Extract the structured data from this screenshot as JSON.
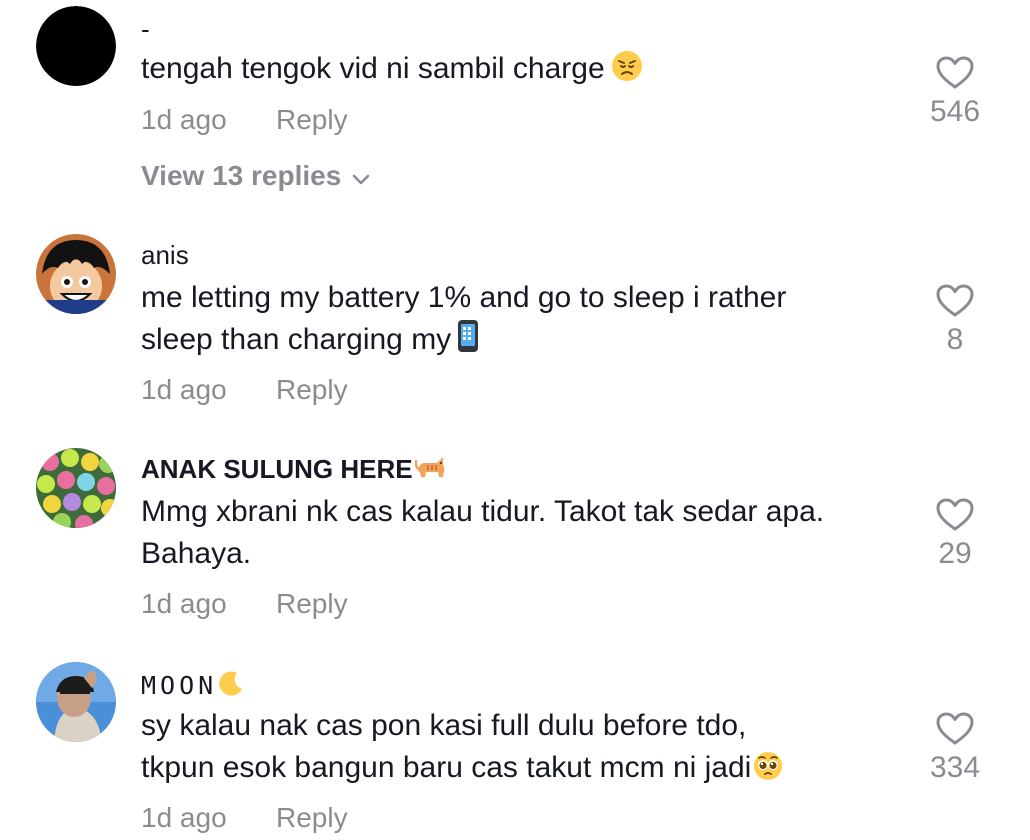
{
  "comments": [
    {
      "username": "-",
      "text": "tengah tengok vid ni sambil charge",
      "emoji": "disappointed-face",
      "time": "1d ago",
      "reply_label": "Reply",
      "likes": "546",
      "view_replies": "View 13 replies"
    },
    {
      "username": "anis",
      "text_line1": "me letting my battery 1% and go to sleep i rather",
      "text_line2": "sleep than charging my",
      "emoji": "mobile-phone",
      "time": "1d ago",
      "reply_label": "Reply",
      "likes": "8"
    },
    {
      "username": "ANAK SULUNG HERE",
      "username_emoji": "cat",
      "text_line1": "Mmg xbrani nk cas kalau tidur. Takot tak sedar apa.",
      "text_line2": "Bahaya.",
      "time": "1d ago",
      "reply_label": "Reply",
      "likes": "29"
    },
    {
      "username": "MOON",
      "username_emoji": "crescent-moon",
      "text_line1": "sy kalau nak cas pon kasi full dulu before tdo,",
      "text_line2": "tkpun esok bangun baru cas takut mcm ni jadi",
      "emoji": "pleading-face",
      "time": "1d ago",
      "reply_label": "Reply",
      "likes": "334"
    }
  ],
  "colors": {
    "primary_text": "#161823",
    "secondary_text": "#8a8b91",
    "background": "#ffffff"
  }
}
